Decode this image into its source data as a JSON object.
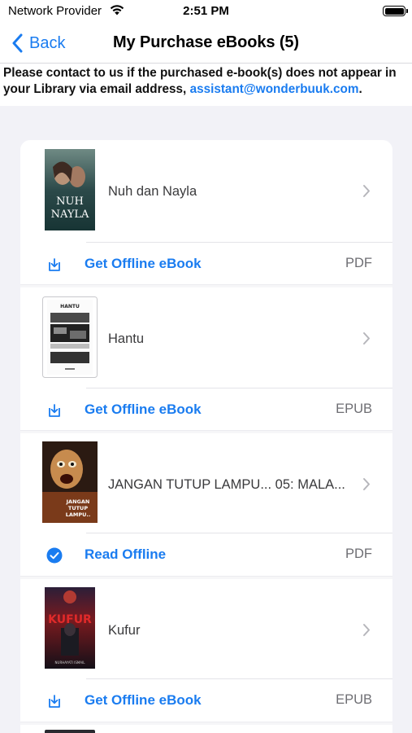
{
  "status": {
    "carrier": "Network Provider",
    "time": "2:51 PM"
  },
  "nav": {
    "back_label": "Back",
    "title": "My Purchase eBooks (5)"
  },
  "notice": {
    "text": "Please contact to us if the purchased e-book(s) does not appear in your Library via email address, ",
    "email": "assistant@wonderbuuk.com",
    "end": "."
  },
  "books": [
    {
      "title": "Nuh dan Nayla",
      "cover_text": "NUH NAYLA",
      "action": "Get Offline eBook",
      "action_icon": "download-icon",
      "format": "PDF"
    },
    {
      "title": "Hantu",
      "cover_text": "HANTU",
      "action": "Get Offline eBook",
      "action_icon": "download-icon",
      "format": "EPUB"
    },
    {
      "title": "JANGAN TUTUP LAMPU... 05: MALA...",
      "cover_text": "JANGAN TUTUP LAMPU...",
      "action": "Read Offline",
      "action_icon": "checkmark-circle-icon",
      "format": "PDF"
    },
    {
      "title": "Kufur",
      "cover_text": "KUFUR",
      "action": "Get Offline eBook",
      "action_icon": "download-icon",
      "format": "EPUB"
    }
  ],
  "colors": {
    "accent": "#1a7cf0",
    "background": "#f2f2f7"
  }
}
